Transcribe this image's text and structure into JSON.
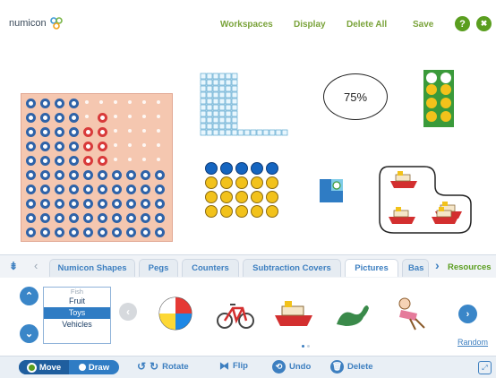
{
  "header": {
    "logo_text": "numicon",
    "menu": [
      "Workspaces",
      "Display",
      "Delete All",
      "Save"
    ],
    "help_label": "?",
    "close_label": "✖"
  },
  "workspace": {
    "percent_label": "75%"
  },
  "tabs": {
    "items": [
      "Numicon Shapes",
      "Pegs",
      "Counters",
      "Subtraction Covers",
      "Pictures",
      "Bas"
    ],
    "active": "Pictures",
    "resources_label": "Resources"
  },
  "tray": {
    "categories": [
      "Fish",
      "Fruit",
      "Toys",
      "Vehicles"
    ],
    "selected_category": "Toys",
    "pictures": [
      "beach-ball",
      "bicycle",
      "boat",
      "dinosaur",
      "doll"
    ],
    "random_label": "Random"
  },
  "toolbar": {
    "move_label": "Move",
    "draw_label": "Draw",
    "rotate_label": "Rotate",
    "flip_label": "Flip",
    "undo_label": "Undo",
    "delete_label": "Delete"
  },
  "colors": {
    "accent_green": "#7aa33a",
    "accent_blue": "#3d7fc0",
    "board_peach": "#f5c7b0",
    "piece_blue": "#2f63a8",
    "piece_red": "#d83a3a",
    "piece_yellow": "#f2c21b",
    "piece_green": "#3a9a3a"
  }
}
